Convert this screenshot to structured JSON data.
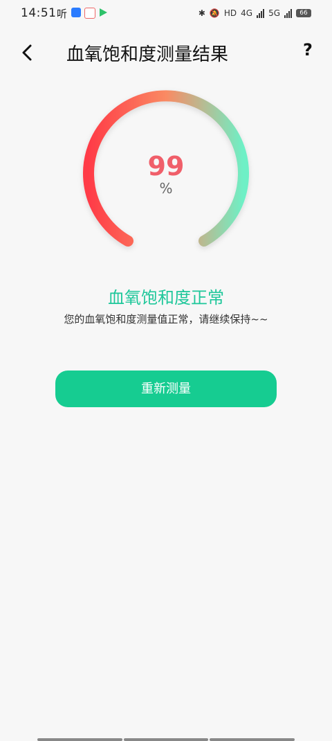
{
  "status_bar": {
    "time": "14:51",
    "listen_label": "听",
    "network_1": "4G",
    "network_2": "5G",
    "hd_label": "HD",
    "battery": "66"
  },
  "header": {
    "title": "血氧饱和度测量结果",
    "help_label": "?"
  },
  "gauge": {
    "value": "99",
    "unit": "%",
    "level": 0.99
  },
  "result": {
    "title": "血氧饱和度正常",
    "description": "您的血氧饱和度测量值正常，请继续保持~~"
  },
  "actions": {
    "remeasure_label": "重新测量"
  },
  "colors": {
    "accent": "#16cc91",
    "result_text": "#1ec79a",
    "value_text": "#f05f6a",
    "arc_start": "#ff3b47",
    "arc_mid": "#fa8a63",
    "arc_end": "#6ef0c6"
  }
}
